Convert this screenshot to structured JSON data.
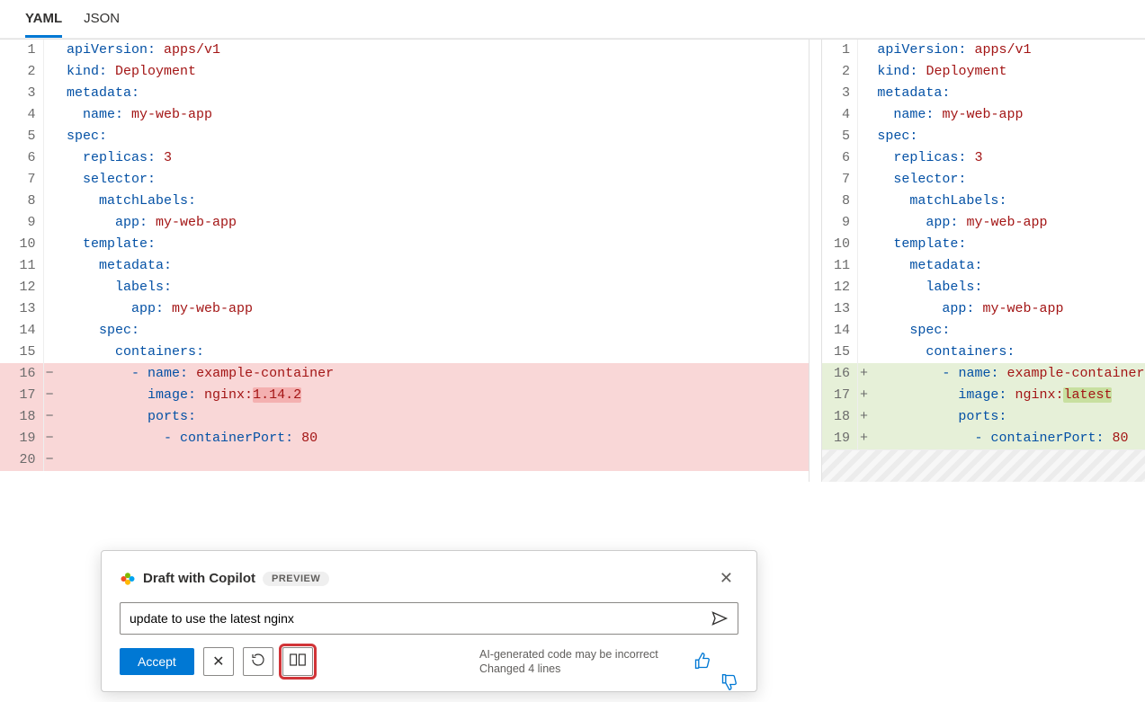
{
  "tabs": {
    "yaml": "YAML",
    "json": "JSON",
    "active": "yaml"
  },
  "left": {
    "lines": [
      {
        "n": 1,
        "type": "ctx",
        "tokens": [
          [
            "key",
            "apiVersion:"
          ],
          [
            "sp",
            " "
          ],
          [
            "val",
            "apps/v1"
          ]
        ]
      },
      {
        "n": 2,
        "type": "ctx",
        "tokens": [
          [
            "key",
            "kind:"
          ],
          [
            "sp",
            " "
          ],
          [
            "val",
            "Deployment"
          ]
        ]
      },
      {
        "n": 3,
        "type": "ctx",
        "tokens": [
          [
            "key",
            "metadata:"
          ]
        ]
      },
      {
        "n": 4,
        "type": "ctx",
        "tokens": [
          [
            "sp",
            "  "
          ],
          [
            "key",
            "name:"
          ],
          [
            "sp",
            " "
          ],
          [
            "val",
            "my-web-app"
          ]
        ]
      },
      {
        "n": 5,
        "type": "ctx",
        "tokens": [
          [
            "key",
            "spec:"
          ]
        ]
      },
      {
        "n": 6,
        "type": "ctx",
        "tokens": [
          [
            "sp",
            "  "
          ],
          [
            "key",
            "replicas:"
          ],
          [
            "sp",
            " "
          ],
          [
            "val",
            "3"
          ]
        ]
      },
      {
        "n": 7,
        "type": "ctx",
        "tokens": [
          [
            "sp",
            "  "
          ],
          [
            "key",
            "selector:"
          ]
        ]
      },
      {
        "n": 8,
        "type": "ctx",
        "tokens": [
          [
            "sp",
            "    "
          ],
          [
            "key",
            "matchLabels:"
          ]
        ]
      },
      {
        "n": 9,
        "type": "ctx",
        "tokens": [
          [
            "sp",
            "      "
          ],
          [
            "key",
            "app:"
          ],
          [
            "sp",
            " "
          ],
          [
            "val",
            "my-web-app"
          ]
        ]
      },
      {
        "n": 10,
        "type": "ctx",
        "tokens": [
          [
            "sp",
            "  "
          ],
          [
            "key",
            "template:"
          ]
        ]
      },
      {
        "n": 11,
        "type": "ctx",
        "tokens": [
          [
            "sp",
            "    "
          ],
          [
            "key",
            "metadata:"
          ]
        ]
      },
      {
        "n": 12,
        "type": "ctx",
        "tokens": [
          [
            "sp",
            "      "
          ],
          [
            "key",
            "labels:"
          ]
        ]
      },
      {
        "n": 13,
        "type": "ctx",
        "tokens": [
          [
            "sp",
            "        "
          ],
          [
            "key",
            "app:"
          ],
          [
            "sp",
            " "
          ],
          [
            "val",
            "my-web-app"
          ]
        ]
      },
      {
        "n": 14,
        "type": "ctx",
        "tokens": [
          [
            "sp",
            "    "
          ],
          [
            "key",
            "spec:"
          ]
        ]
      },
      {
        "n": 15,
        "type": "ctx",
        "tokens": [
          [
            "sp",
            "      "
          ],
          [
            "key",
            "containers:"
          ]
        ]
      },
      {
        "n": 16,
        "type": "del",
        "tokens": [
          [
            "sp",
            "        "
          ],
          [
            "dash",
            "- "
          ],
          [
            "key",
            "name:"
          ],
          [
            "sp",
            " "
          ],
          [
            "val",
            "example-container"
          ]
        ]
      },
      {
        "n": 17,
        "type": "del",
        "tokens": [
          [
            "sp",
            "          "
          ],
          [
            "key",
            "image:"
          ],
          [
            "sp",
            " "
          ],
          [
            "val",
            "nginx:"
          ],
          [
            "valhl",
            "1.14.2"
          ]
        ]
      },
      {
        "n": 18,
        "type": "del",
        "tokens": [
          [
            "sp",
            "          "
          ],
          [
            "key",
            "ports:"
          ]
        ]
      },
      {
        "n": 19,
        "type": "del",
        "tokens": [
          [
            "sp",
            "            "
          ],
          [
            "dash",
            "- "
          ],
          [
            "key",
            "containerPort:"
          ],
          [
            "sp",
            " "
          ],
          [
            "val",
            "80"
          ]
        ]
      },
      {
        "n": 20,
        "type": "del-empty",
        "tokens": []
      }
    ]
  },
  "right": {
    "lines": [
      {
        "n": 1,
        "type": "ctx",
        "tokens": [
          [
            "key",
            "apiVersion:"
          ],
          [
            "sp",
            " "
          ],
          [
            "val",
            "apps/v1"
          ]
        ]
      },
      {
        "n": 2,
        "type": "ctx",
        "tokens": [
          [
            "key",
            "kind:"
          ],
          [
            "sp",
            " "
          ],
          [
            "val",
            "Deployment"
          ]
        ]
      },
      {
        "n": 3,
        "type": "ctx",
        "tokens": [
          [
            "key",
            "metadata:"
          ]
        ]
      },
      {
        "n": 4,
        "type": "ctx",
        "tokens": [
          [
            "sp",
            "  "
          ],
          [
            "key",
            "name:"
          ],
          [
            "sp",
            " "
          ],
          [
            "val",
            "my-web-app"
          ]
        ]
      },
      {
        "n": 5,
        "type": "ctx",
        "tokens": [
          [
            "key",
            "spec:"
          ]
        ]
      },
      {
        "n": 6,
        "type": "ctx",
        "tokens": [
          [
            "sp",
            "  "
          ],
          [
            "key",
            "replicas:"
          ],
          [
            "sp",
            " "
          ],
          [
            "val",
            "3"
          ]
        ]
      },
      {
        "n": 7,
        "type": "ctx",
        "tokens": [
          [
            "sp",
            "  "
          ],
          [
            "key",
            "selector:"
          ]
        ]
      },
      {
        "n": 8,
        "type": "ctx",
        "tokens": [
          [
            "sp",
            "    "
          ],
          [
            "key",
            "matchLabels:"
          ]
        ]
      },
      {
        "n": 9,
        "type": "ctx",
        "tokens": [
          [
            "sp",
            "      "
          ],
          [
            "key",
            "app:"
          ],
          [
            "sp",
            " "
          ],
          [
            "val",
            "my-web-app"
          ]
        ]
      },
      {
        "n": 10,
        "type": "ctx",
        "tokens": [
          [
            "sp",
            "  "
          ],
          [
            "key",
            "template:"
          ]
        ]
      },
      {
        "n": 11,
        "type": "ctx",
        "tokens": [
          [
            "sp",
            "    "
          ],
          [
            "key",
            "metadata:"
          ]
        ]
      },
      {
        "n": 12,
        "type": "ctx",
        "tokens": [
          [
            "sp",
            "      "
          ],
          [
            "key",
            "labels:"
          ]
        ]
      },
      {
        "n": 13,
        "type": "ctx",
        "tokens": [
          [
            "sp",
            "        "
          ],
          [
            "key",
            "app:"
          ],
          [
            "sp",
            " "
          ],
          [
            "val",
            "my-web-app"
          ]
        ]
      },
      {
        "n": 14,
        "type": "ctx",
        "tokens": [
          [
            "sp",
            "    "
          ],
          [
            "key",
            "spec:"
          ]
        ]
      },
      {
        "n": 15,
        "type": "ctx",
        "tokens": [
          [
            "sp",
            "      "
          ],
          [
            "key",
            "containers:"
          ]
        ]
      },
      {
        "n": 16,
        "type": "add",
        "tokens": [
          [
            "sp",
            "        "
          ],
          [
            "dash",
            "- "
          ],
          [
            "key",
            "name:"
          ],
          [
            "sp",
            " "
          ],
          [
            "val",
            "example-container"
          ]
        ]
      },
      {
        "n": 17,
        "type": "add",
        "tokens": [
          [
            "sp",
            "          "
          ],
          [
            "key",
            "image:"
          ],
          [
            "sp",
            " "
          ],
          [
            "val",
            "nginx:"
          ],
          [
            "valhl",
            "latest"
          ]
        ]
      },
      {
        "n": 18,
        "type": "add",
        "tokens": [
          [
            "sp",
            "          "
          ],
          [
            "key",
            "ports:"
          ]
        ]
      },
      {
        "n": 19,
        "type": "add",
        "tokens": [
          [
            "sp",
            "            "
          ],
          [
            "dash",
            "- "
          ],
          [
            "key",
            "containerPort:"
          ],
          [
            "sp",
            " "
          ],
          [
            "val",
            "80"
          ]
        ]
      }
    ]
  },
  "copilot": {
    "title": "Draft with Copilot",
    "badge": "PREVIEW",
    "input_value": "update to use the latest nginx",
    "accept": "Accept",
    "msg_line1": "AI-generated code may be incorrect",
    "msg_line2": "Changed 4 lines"
  }
}
